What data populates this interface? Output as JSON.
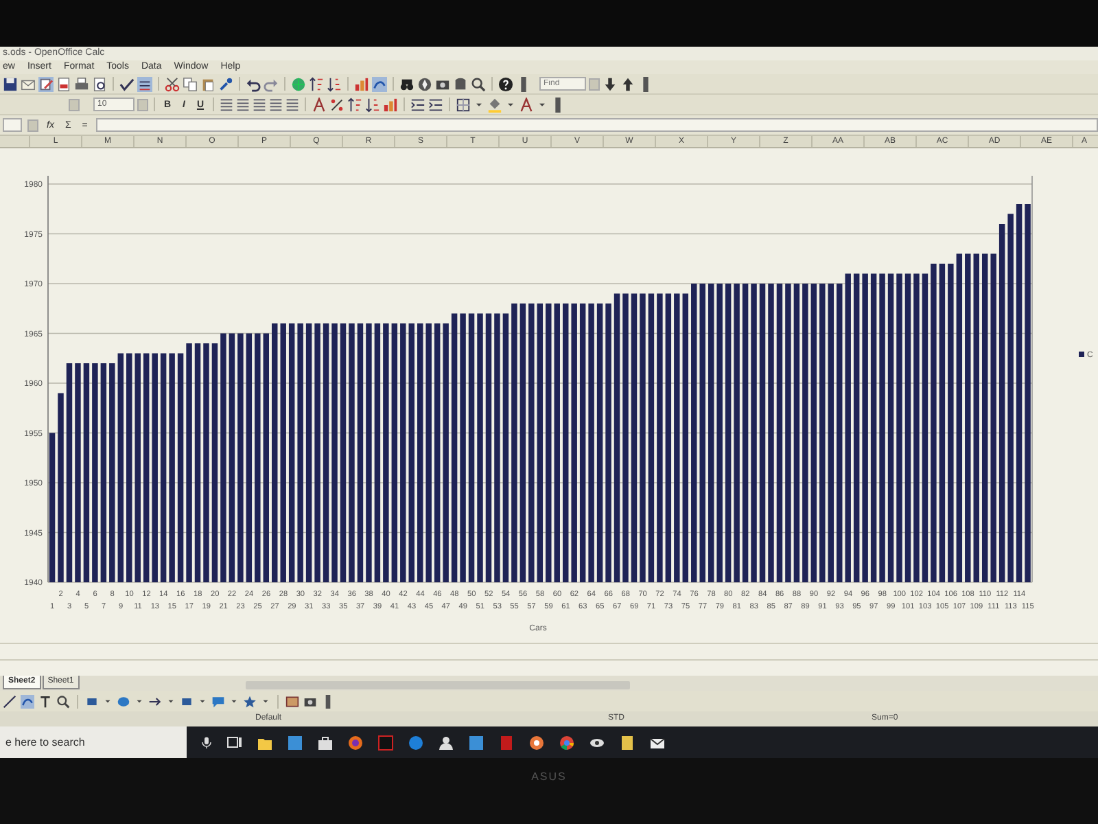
{
  "window": {
    "title": "s.ods - OpenOffice Calc"
  },
  "menu": [
    "ew",
    "Insert",
    "Format",
    "Tools",
    "Data",
    "Window",
    "Help"
  ],
  "find_field": {
    "placeholder": "Find"
  },
  "format_bar": {
    "font_size": "10",
    "style_buttons": [
      "B",
      "I",
      "U"
    ]
  },
  "formula_bar": {
    "buttons": [
      "fx",
      "Σ",
      "="
    ]
  },
  "column_headers": [
    "L",
    "M",
    "N",
    "O",
    "P",
    "Q",
    "R",
    "S",
    "T",
    "U",
    "V",
    "W",
    "X",
    "Y",
    "Z",
    "AA",
    "AB",
    "AC",
    "AD",
    "AE",
    "A"
  ],
  "chart": {
    "chart_data": {
      "type": "bar",
      "xlabel": "Cars",
      "categories": [
        "1",
        "2",
        "3",
        "4",
        "5",
        "6",
        "7",
        "8",
        "9",
        "10",
        "11",
        "12",
        "13",
        "14",
        "15",
        "16",
        "17",
        "18",
        "19",
        "20",
        "21",
        "22",
        "23",
        "24",
        "25",
        "26",
        "27",
        "28",
        "29",
        "30",
        "31",
        "32",
        "33",
        "34",
        "35",
        "36",
        "37",
        "38",
        "39",
        "40",
        "41",
        "42",
        "43",
        "44",
        "45",
        "46",
        "47",
        "48",
        "49",
        "50",
        "51",
        "52",
        "53",
        "54",
        "55",
        "56",
        "57",
        "58",
        "59",
        "60",
        "61",
        "62",
        "63",
        "64",
        "65",
        "66",
        "67",
        "68",
        "69",
        "70",
        "71",
        "72",
        "73",
        "74",
        "75",
        "76",
        "77",
        "78",
        "79",
        "80",
        "81",
        "82",
        "83",
        "84",
        "85",
        "86",
        "87",
        "88",
        "89",
        "90",
        "91",
        "92",
        "93",
        "94",
        "95",
        "96",
        "97",
        "98",
        "99",
        "100",
        "101",
        "102",
        "103",
        "104",
        "105",
        "106",
        "107",
        "108",
        "109",
        "110",
        "111",
        "112",
        "113",
        "114",
        "115"
      ],
      "series": [
        {
          "name": "C",
          "color": "#1f2356",
          "values": [
            1955,
            1959,
            1962,
            1962,
            1962,
            1962,
            1962,
            1962,
            1963,
            1963,
            1963,
            1963,
            1963,
            1963,
            1963,
            1963,
            1964,
            1964,
            1964,
            1964,
            1965,
            1965,
            1965,
            1965,
            1965,
            1965,
            1966,
            1966,
            1966,
            1966,
            1966,
            1966,
            1966,
            1966,
            1966,
            1966,
            1966,
            1966,
            1966,
            1966,
            1966,
            1966,
            1966,
            1966,
            1966,
            1966,
            1966,
            1967,
            1967,
            1967,
            1967,
            1967,
            1967,
            1967,
            1968,
            1968,
            1968,
            1968,
            1968,
            1968,
            1968,
            1968,
            1968,
            1968,
            1968,
            1968,
            1969,
            1969,
            1969,
            1969,
            1969,
            1969,
            1969,
            1969,
            1969,
            1970,
            1970,
            1970,
            1970,
            1970,
            1970,
            1970,
            1970,
            1970,
            1970,
            1970,
            1970,
            1970,
            1970,
            1970,
            1970,
            1970,
            1970,
            1971,
            1971,
            1971,
            1971,
            1971,
            1971,
            1971,
            1971,
            1971,
            1971,
            1972,
            1972,
            1972,
            1973,
            1973,
            1973,
            1973,
            1973,
            1976,
            1977,
            1978,
            1978
          ]
        }
      ],
      "grid": true,
      "ylim": [
        1940,
        1980
      ],
      "yticks": [
        1940,
        1945,
        1950,
        1955,
        1960,
        1965,
        1970,
        1975,
        1980
      ]
    }
  },
  "sheet_tabs": [
    {
      "label": "Sheet2",
      "selected": true
    },
    {
      "label": "Sheet1",
      "selected": false
    }
  ],
  "status_bar": {
    "page_style": "Default",
    "mode": "STD",
    "sum": "Sum=0"
  },
  "taskbar": {
    "search": {
      "placeholder": "e here to search"
    }
  },
  "bezel": {
    "logo": "ASUS"
  }
}
